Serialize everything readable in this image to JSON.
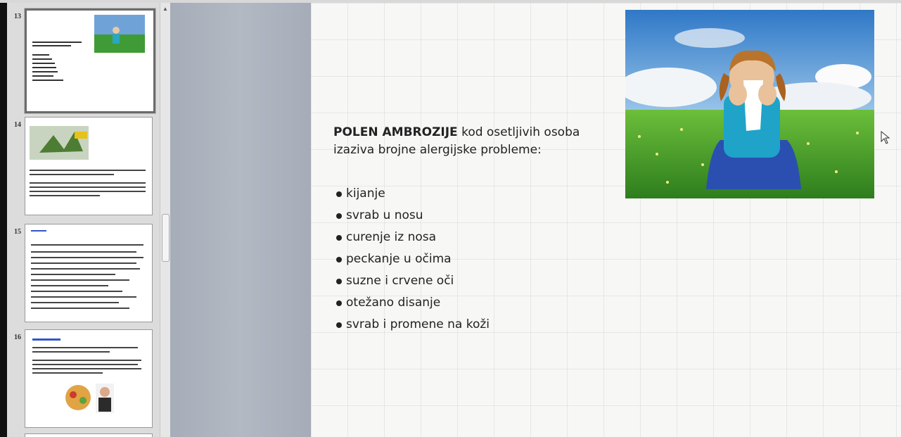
{
  "thumbnails": [
    {
      "number": "13",
      "selected": true
    },
    {
      "number": "14",
      "selected": false
    },
    {
      "number": "15",
      "selected": false
    },
    {
      "number": "16",
      "selected": false
    }
  ],
  "slide": {
    "heading_bold": "POLEN AMBROZIJE",
    "heading_rest_line1": " kod osetljivih osoba",
    "heading_line2": "izaziva brojne alergijske probleme:",
    "bullets": [
      "kijanje",
      "svrab u nosu",
      "curenje iz nosa",
      "peckanje u očima",
      "suzne i crvene oči",
      "otežano disanje",
      "svrab i promene na koži"
    ],
    "image_icon": "girl-sneezing-in-meadow-photo"
  },
  "icons": {
    "cursor": "mouse-pointer-icon",
    "scroll_up": "scroll-up-arrow-icon"
  },
  "colors": {
    "panel_bg": "#dcdcdc",
    "workspace_bg": "#aeb4be",
    "slide_bg": "#f7f7f6",
    "text": "#222222"
  }
}
